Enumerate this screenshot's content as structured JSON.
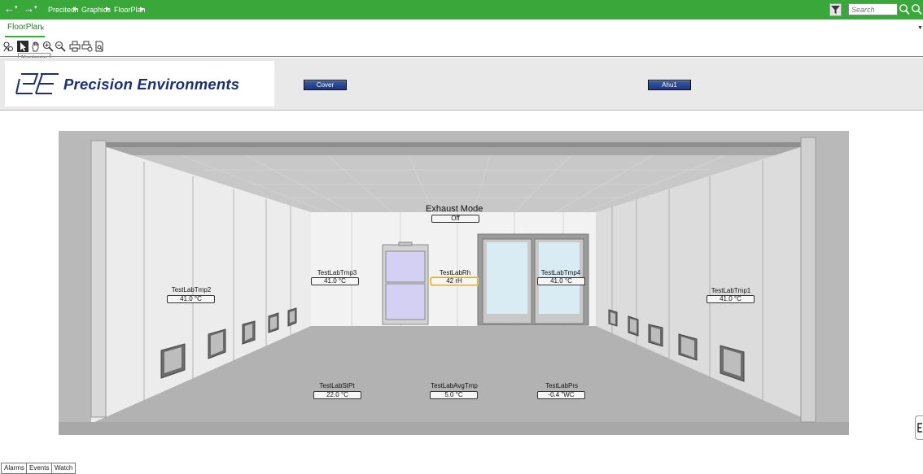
{
  "nav": {
    "back_icon": "arrow-left-icon",
    "forward_icon": "arrow-right-icon",
    "breadcrumbs": [
      "Precitech",
      "Graphics",
      "FloorPlan"
    ]
  },
  "search": {
    "placeholder": "Search"
  },
  "tabs": [
    {
      "label": "FloorPlan",
      "close": "×"
    }
  ],
  "toolbar": {
    "tools": [
      "select-icon",
      "navigate-icon",
      "pan-icon",
      "zoom-in-icon",
      "zoom-out-icon",
      "print-icon",
      "print-setup-icon",
      "print-preview-icon"
    ],
    "tooltip": "Navigate"
  },
  "header": {
    "logo_text": "Precision Environments",
    "buttons": {
      "cover": "Cover",
      "ahu": "Ahu1"
    }
  },
  "floorplan": {
    "exhaust": {
      "label": "Exhaust Mode",
      "value": "Off"
    },
    "tags": {
      "tmp2": {
        "label": "TestLabTmp2",
        "value": "41.0 °C"
      },
      "tmp3": {
        "label": "TestLabTmp3",
        "value": "41.0 °C"
      },
      "rh": {
        "label": "TestLabRh",
        "value": "42 rH"
      },
      "tmp4": {
        "label": "TestLabTmp4",
        "value": "41.0 °C"
      },
      "tmp1": {
        "label": "TestLabTmp1",
        "value": "41.0 °C"
      },
      "stpt": {
        "label": "TestLabStPt",
        "value": "22.0 °C"
      },
      "avgtmp": {
        "label": "TestLabAvgTmp",
        "value": "5.0 °C"
      },
      "prs": {
        "label": "TestLabPrs",
        "value": "-0.4 \"WC"
      }
    }
  },
  "bottom_tabs": [
    "Alarms",
    "Events",
    "Watch"
  ],
  "colors": {
    "topbar": "#3aa73a",
    "button": "#1d3680",
    "logo": "#1d2f6f",
    "highlight": "#e8a800"
  }
}
